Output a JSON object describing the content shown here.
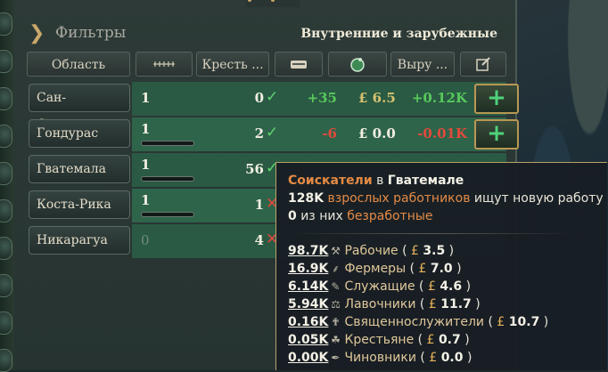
{
  "filters": {
    "label": "Фильтры",
    "region_selector": "Внутренние и зарубежные"
  },
  "columns": {
    "region": "Область",
    "pop_icon": "population-icon",
    "peasants": "Кресть ...",
    "migration_icon": "migration-icon",
    "wage_icon": "coin-icon",
    "output": "Выру ...",
    "action_icon": "edit-icon"
  },
  "rows": [
    {
      "name": "Сан-Сальвадор",
      "pop": "1",
      "peasants": "0",
      "status": "ok",
      "change": "+35",
      "change_sign": "pos",
      "wage": "£ 6.5",
      "wage_color": "gold",
      "output": "+0.12K",
      "output_sign": "pos",
      "has_bar": false,
      "button": "+"
    },
    {
      "name": "Гондурас",
      "pop": "1",
      "peasants": "2",
      "status": "ok",
      "change": "-6",
      "change_sign": "neg",
      "wage": "£ 0.0",
      "wage_color": "white",
      "output": "-0.01K",
      "output_sign": "neg",
      "has_bar": true,
      "button": "+"
    },
    {
      "name": "Гватемала",
      "pop": "1",
      "peasants": "56",
      "status": "ok",
      "has_bar": true
    },
    {
      "name": "Коста-Рика",
      "pop": "1",
      "peasants": "1",
      "status": "bad",
      "has_bar": true
    },
    {
      "name": "Никарагуа",
      "pop": "0",
      "peasants": "4",
      "status": "bad",
      "has_bar": false
    }
  ],
  "tooltip": {
    "title_a": "Соискатели",
    "title_b": "в",
    "title_c": "Гватемале",
    "line1_a": "128K",
    "line1_b": "взрослых работников",
    "line1_c": "ищут новую работу",
    "line2_a": "0",
    "line2_b": "из них",
    "line2_c": "безработные",
    "jobs": [
      {
        "amount": "98.7K",
        "icon": "laborer-icon",
        "name": "Рабочие",
        "wage": "3.5"
      },
      {
        "amount": "16.9K",
        "icon": "farmer-icon",
        "name": "Фермеры",
        "wage": "7.0"
      },
      {
        "amount": "6.14K",
        "icon": "clerk-icon",
        "name": "Служащие",
        "wage": "4.6"
      },
      {
        "amount": "5.94K",
        "icon": "shopkeeper-icon",
        "name": "Лавочники",
        "wage": "11.7"
      },
      {
        "amount": "0.16K",
        "icon": "clergy-icon",
        "name": "Священнослужители",
        "wage": "10.7"
      },
      {
        "amount": "0.05K",
        "icon": "peasant-icon",
        "name": "Крестьяне",
        "wage": "0.7"
      },
      {
        "amount": "0.00K",
        "icon": "bureaucrat-icon",
        "name": "Чиновники",
        "wage": "0.0"
      }
    ]
  },
  "colors": {
    "accent": "#e58a45",
    "gold": "#e7b25a",
    "positive": "#58c85c",
    "negative": "#e04a3c",
    "row_bg": "#2a5a43"
  }
}
